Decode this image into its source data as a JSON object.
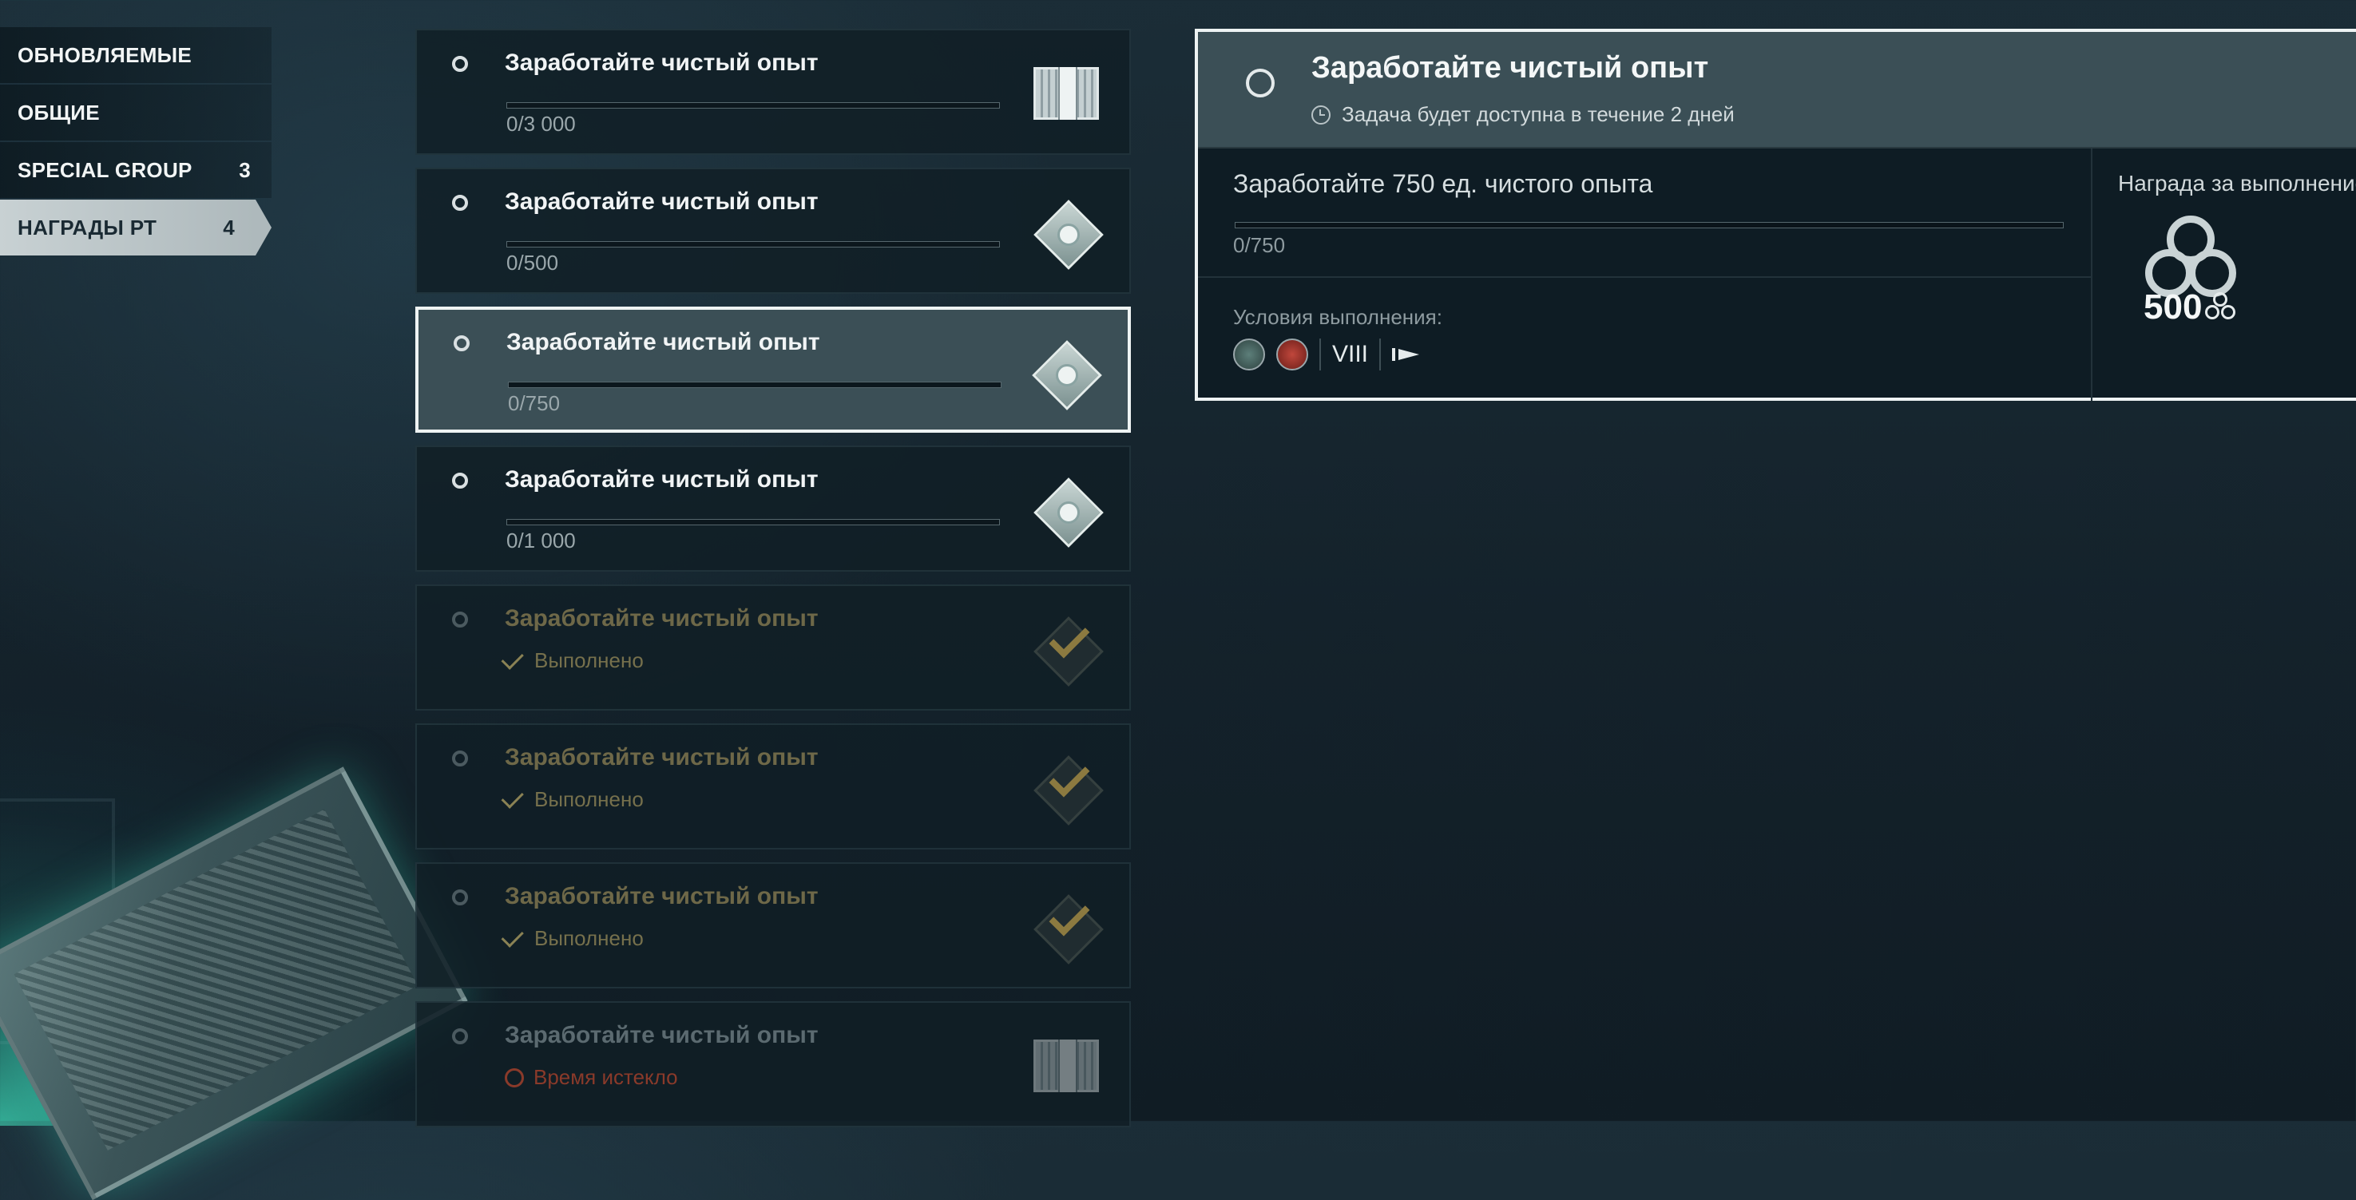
{
  "sidebar": {
    "items": [
      {
        "label": "ОБНОВЛЯЕМЫЕ",
        "count": ""
      },
      {
        "label": "ОБЩИЕ",
        "count": ""
      },
      {
        "label": "SPECIAL GROUP",
        "count": "3"
      },
      {
        "label": "НАГРАДЫ РТ",
        "count": "4"
      }
    ],
    "active_index": 3
  },
  "tasks": [
    {
      "title": "Заработайте чистый опыт",
      "value": "0/3 000",
      "progress": 0,
      "state": "available",
      "icon": "crate-icon"
    },
    {
      "title": "Заработайте чистый опыт",
      "value": "0/500",
      "progress": 0,
      "state": "available",
      "icon": "diamond-icon"
    },
    {
      "title": "Заработайте чистый опыт",
      "value": "0/750",
      "progress": 0,
      "state": "selected",
      "icon": "diamond-icon"
    },
    {
      "title": "Заработайте чистый опыт",
      "value": "0/1 000",
      "progress": 0,
      "state": "available",
      "icon": "diamond-icon"
    },
    {
      "title": "Заработайте чистый опыт",
      "status": "Выполнено",
      "state": "done",
      "icon": "checkmark-icon"
    },
    {
      "title": "Заработайте чистый опыт",
      "status": "Выполнено",
      "state": "done",
      "icon": "checkmark-icon"
    },
    {
      "title": "Заработайте чистый опыт",
      "status": "Выполнено",
      "state": "done",
      "icon": "checkmark-icon"
    },
    {
      "title": "Заработайте чистый опыт",
      "status": "Время истекло",
      "state": "expired",
      "icon": "crate-icon"
    }
  ],
  "detail": {
    "title": "Заработайте чистый опыт",
    "availability": "Задача будет доступна в течение 2 дней",
    "task_text": "Заработайте 750 ед. чистого опыта",
    "progress_value": "0/750",
    "progress": 0,
    "conditions_label": "Условия выполнения:",
    "tier": "VIII",
    "reward_label": "Награда за выполнение:",
    "reward_amount": "500"
  },
  "colors": {
    "accent_selected": "#3b4f56",
    "done_text": "#76704c",
    "expired_text": "#8a3a2a"
  }
}
